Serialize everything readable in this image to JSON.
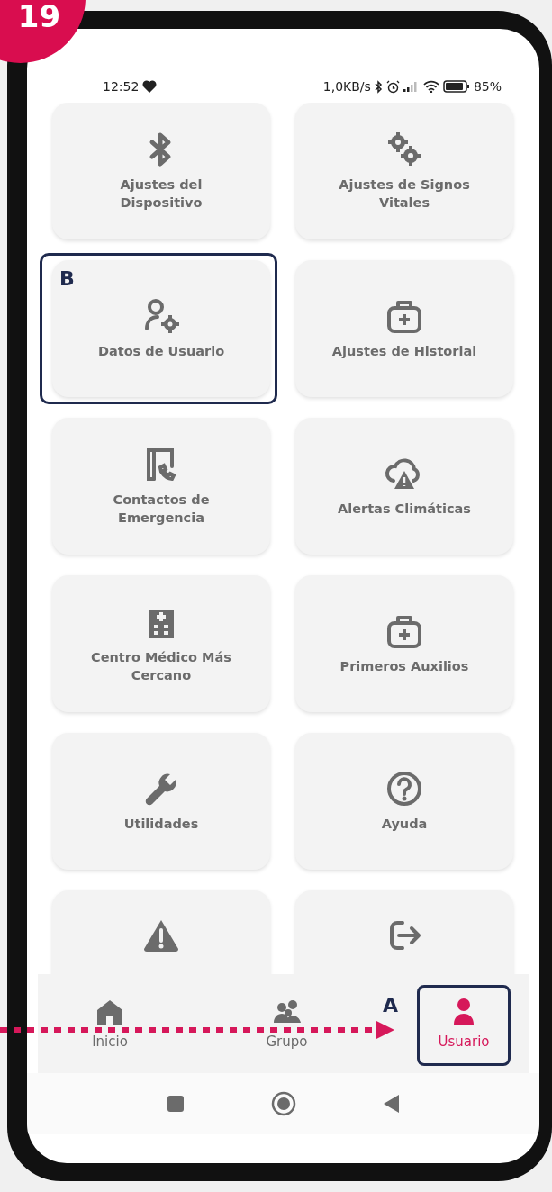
{
  "step_badge": "19",
  "status_bar": {
    "time": "12:52",
    "speed": "1,0KB/s",
    "battery": "85%"
  },
  "cards": [
    {
      "label": "Ajustes del Dispositivo"
    },
    {
      "label": "Ajustes de Signos Vitales"
    },
    {
      "label": "Datos de Usuario",
      "callout": "B"
    },
    {
      "label": "Ajustes de Historial"
    },
    {
      "label": "Contactos de Emergencia"
    },
    {
      "label": "Alertas Climáticas"
    },
    {
      "label": "Centro Médico Más Cercano"
    },
    {
      "label": "Primeros Auxilios"
    },
    {
      "label": "Utilidades"
    },
    {
      "label": "Ayuda"
    },
    {
      "kind": "clipped"
    },
    {
      "kind": "clipped"
    }
  ],
  "tabs": [
    {
      "label": "Inicio",
      "selected": false
    },
    {
      "label": "Grupo",
      "selected": false
    },
    {
      "label": "Usuario",
      "selected": true,
      "callout": "A"
    }
  ]
}
